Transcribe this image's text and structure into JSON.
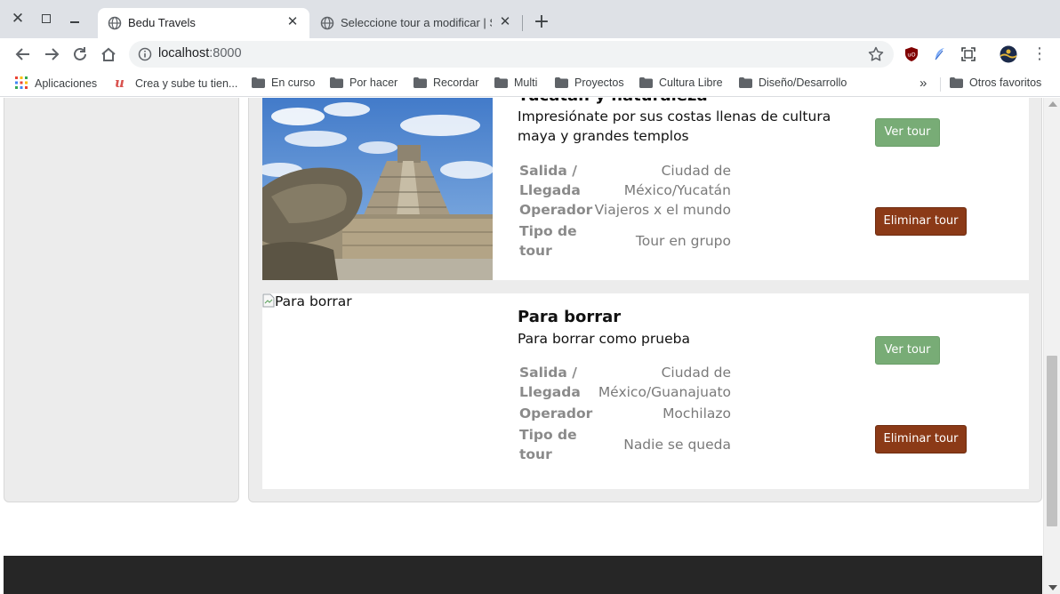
{
  "browser": {
    "tabs": [
      {
        "title": "Bedu Travels",
        "active": true
      },
      {
        "title": "Seleccione tour a modificar | Sitio",
        "active": false
      }
    ],
    "url_host": "localhost",
    "url_port": ":8000",
    "bookmarks": [
      {
        "label": "Aplicaciones",
        "icon": "apps-grid-icon"
      },
      {
        "label": "Crea y sube tu tien...",
        "icon": "u-logo-icon"
      },
      {
        "label": "En curso",
        "icon": "folder-icon"
      },
      {
        "label": "Por hacer",
        "icon": "folder-icon"
      },
      {
        "label": "Recordar",
        "icon": "folder-icon"
      },
      {
        "label": "Multi",
        "icon": "folder-icon"
      },
      {
        "label": "Proyectos",
        "icon": "folder-icon"
      },
      {
        "label": "Cultura Libre",
        "icon": "folder-icon"
      },
      {
        "label": "Diseño/Desarrollo",
        "icon": "folder-icon"
      }
    ],
    "bookmarks_more": "»",
    "other_bookmarks": "Otros favoritos"
  },
  "tours": [
    {
      "title": "Yucatán y naturaleza",
      "description": "Impresiónate por sus costas llenas de cultura maya y grandes templos",
      "details": [
        {
          "label": "Salida / Llegada",
          "value": "Ciudad de México/Yucatán"
        },
        {
          "label": "Operador",
          "value": "Viajeros x el mundo"
        },
        {
          "label": "Tipo de tour",
          "value": "Tour en grupo"
        }
      ],
      "view_label": "Ver tour",
      "delete_label": "Eliminar tour"
    },
    {
      "title": "Para borrar",
      "image_alt": "Para borrar",
      "description": "Para borrar como prueba",
      "details": [
        {
          "label": "Salida / Llegada",
          "value": "Ciudad de México/Guanajuato"
        },
        {
          "label": "Operador",
          "value": "Mochilazo"
        },
        {
          "label": "Tipo de tour",
          "value": "Nadie se queda"
        }
      ],
      "view_label": "Ver tour",
      "delete_label": "Eliminar tour"
    }
  ],
  "colors": {
    "view_button": "#78ac76",
    "delete_button": "#8b3a17",
    "footer": "#262626",
    "card_bg": "#ececec"
  }
}
